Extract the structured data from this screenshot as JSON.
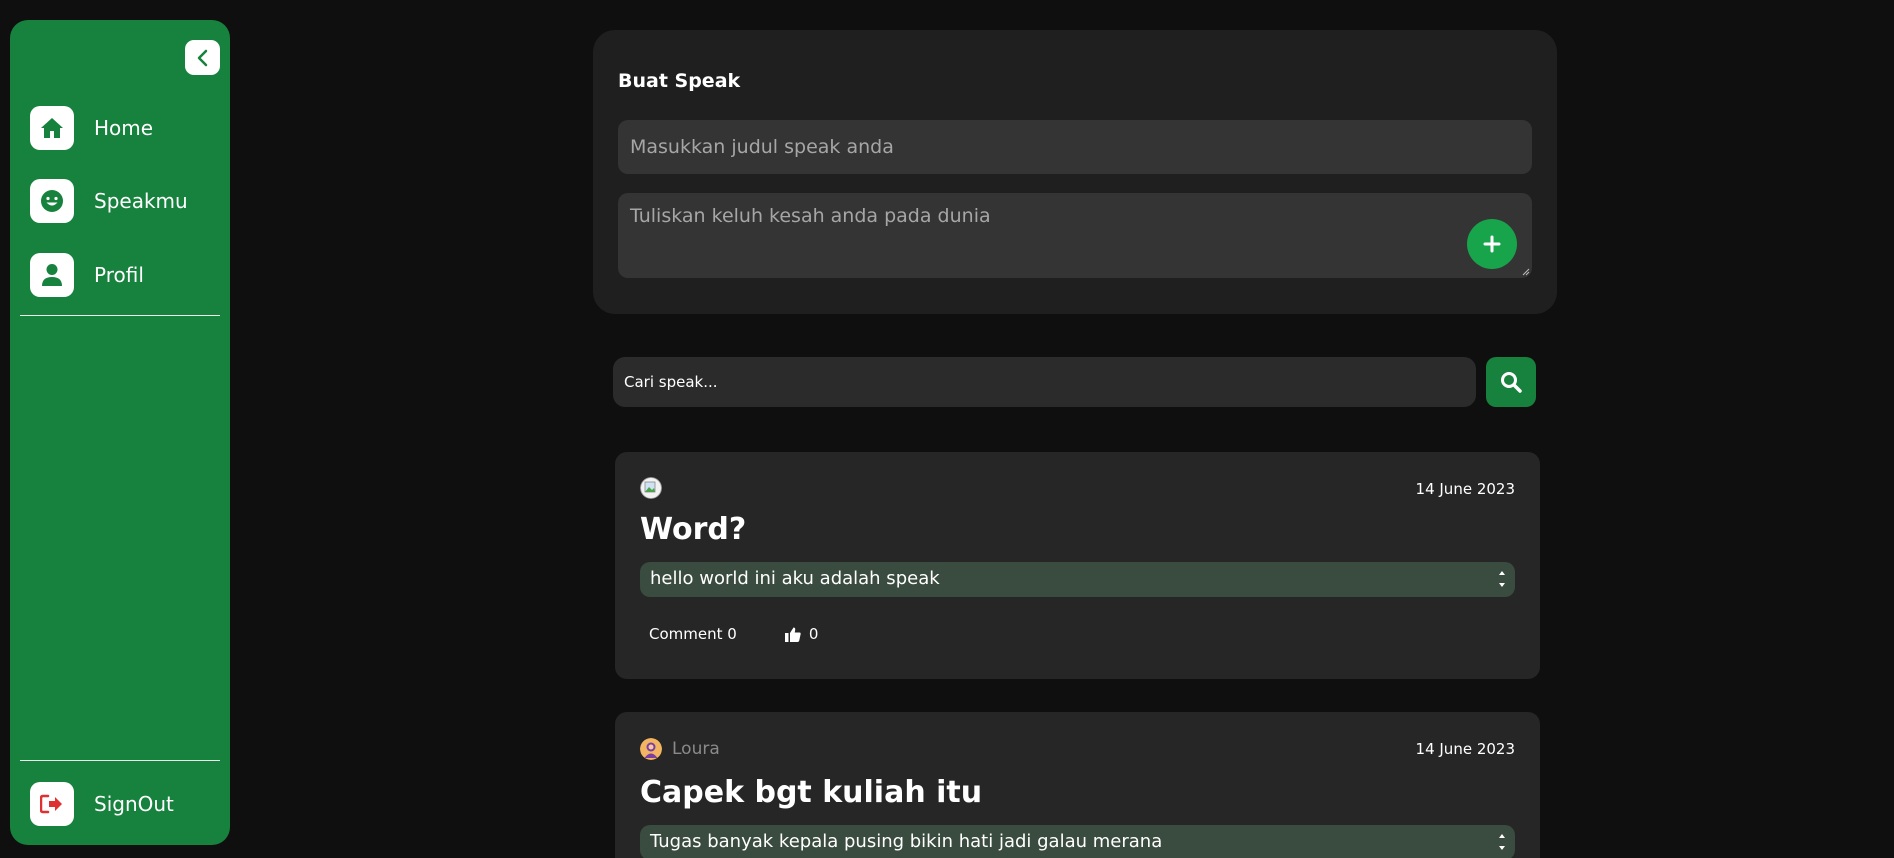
{
  "sidebar": {
    "items": [
      {
        "label": "Home",
        "icon": "home-icon"
      },
      {
        "label": "Speakmu",
        "icon": "smile-icon"
      },
      {
        "label": "Profil",
        "icon": "user-icon"
      }
    ],
    "signout_label": "SignOut"
  },
  "create": {
    "title": "Buat Speak",
    "title_placeholder": "Masukkan judul speak anda",
    "body_placeholder": "Tuliskan keluh kesah anda pada dunia"
  },
  "search": {
    "placeholder": "Cari speak..."
  },
  "posts": [
    {
      "author": "",
      "date": "14 June 2023",
      "title": "Word?",
      "body": "hello world ini aku adalah speak",
      "comment_label": "Comment 0",
      "likes": "0"
    },
    {
      "author": "Loura",
      "date": "14 June 2023",
      "title": "Capek bgt kuliah itu",
      "body": "Tugas banyak kepala pusing bikin hati jadi galau merana"
    }
  ],
  "colors": {
    "accent": "#17823d",
    "button_green": "#18a44b",
    "background": "#0f0f0f",
    "card": "#1f1f1f",
    "signout_red": "#e03131"
  }
}
